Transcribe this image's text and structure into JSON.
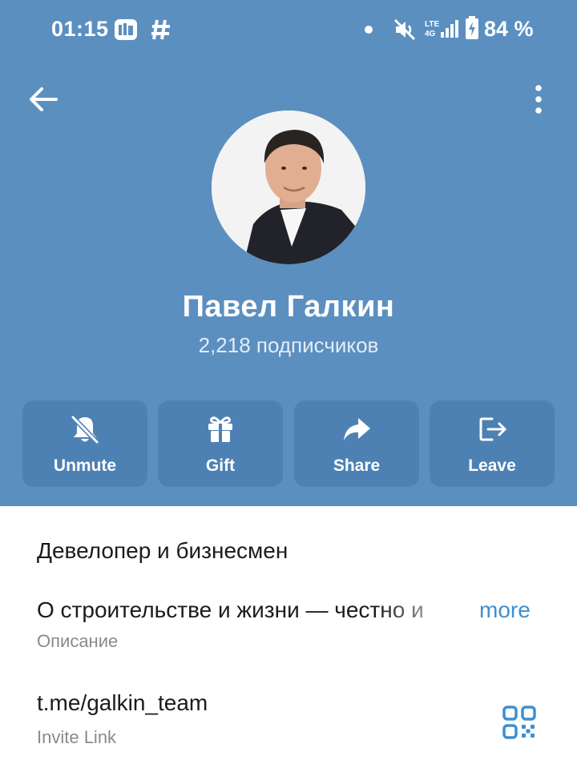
{
  "status_bar": {
    "time": "01:15",
    "battery": "84 %",
    "icons": [
      "app-notification-icon",
      "app-hashtag-icon",
      "notification-dot-icon",
      "mute-icon",
      "lte-signal-icon",
      "battery-charging-icon"
    ]
  },
  "toolbar": {
    "back_icon": "arrow-left-icon",
    "more_icon": "vertical-dots-icon"
  },
  "profile": {
    "name": "Павел Галкин",
    "subscribers": "2,218 подписчиков"
  },
  "actions": [
    {
      "label": "Unmute",
      "icon": "bell-off-icon"
    },
    {
      "label": "Gift",
      "icon": "gift-icon"
    },
    {
      "label": "Share",
      "icon": "share-arrow-icon"
    },
    {
      "label": "Leave",
      "icon": "leave-icon"
    }
  ],
  "info": {
    "bio": "Девелопер и бизнесмен",
    "description": "О строительстве и жизни — честно и",
    "more": "more",
    "description_caption": "Описание",
    "link": "t.me/galkin_team",
    "link_caption": "Invite Link",
    "qr_icon": "qr-code-icon"
  },
  "colors": {
    "header_bg": "#5b8fc0",
    "action_bg": "#4e81b3",
    "accent": "#3e8fd0",
    "text": "#1b1b1b",
    "caption": "#8a8a8a"
  }
}
